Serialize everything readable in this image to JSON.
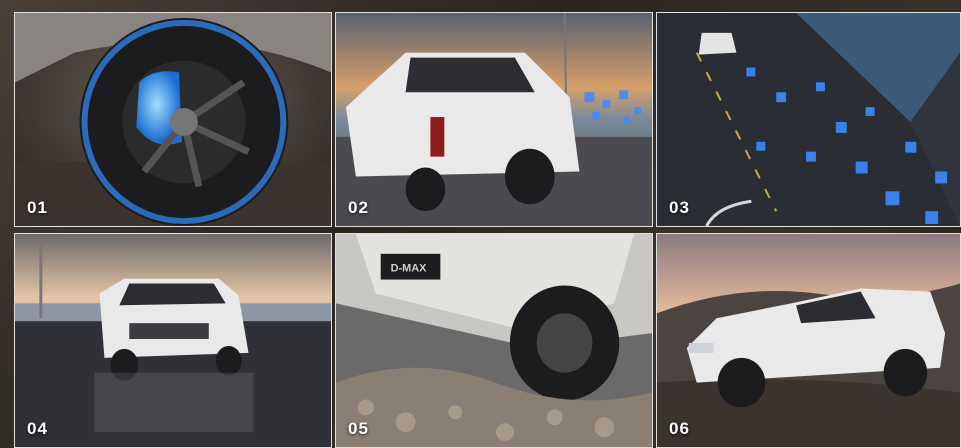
{
  "tiles": [
    {
      "number": "01",
      "subject": "wheel-with-blue-brake-highlight"
    },
    {
      "number": "02",
      "subject": "white-pickup-rear-view-on-pier"
    },
    {
      "number": "03",
      "subject": "pickup-on-road-with-blue-sensor-cubes"
    },
    {
      "number": "04",
      "subject": "white-pickup-front-view-on-wet-road"
    },
    {
      "number": "05",
      "subject": "pickup-climbing-rocky-terrain"
    },
    {
      "number": "06",
      "subject": "white-pickup-side-view-hillside"
    }
  ],
  "badge_text": "D-MAX",
  "colors": {
    "accent_blue": "#3a8cff",
    "truck_white": "#e9e9ea"
  }
}
